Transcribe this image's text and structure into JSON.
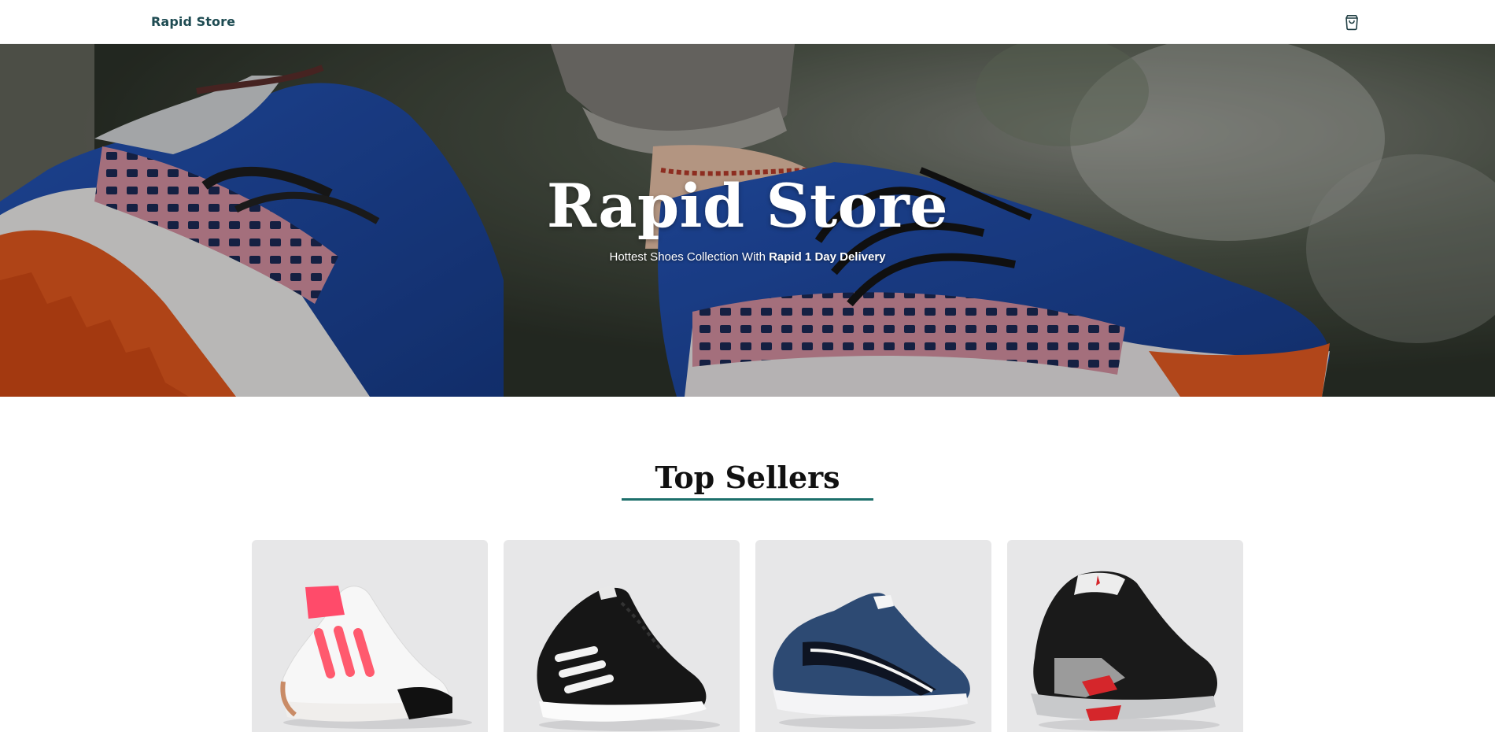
{
  "navbar": {
    "brand": "Rapid Store",
    "cart_icon": "shopping-bag-icon"
  },
  "hero": {
    "title": "Rapid Store",
    "subtitle_prefix": "Hottest Shoes Collection With ",
    "subtitle_emphasis": "Rapid 1 Day Delivery",
    "background_image": "sneaker-photo"
  },
  "section": {
    "title": "Top Sellers",
    "accent_color": "#1d6f6b"
  },
  "products": [
    {
      "image": "white-pink-running-shoe"
    },
    {
      "image": "black-white-stripe-shoe"
    },
    {
      "image": "navy-puma-shoe"
    },
    {
      "image": "black-grey-red-basketball-shoe"
    }
  ],
  "colors": {
    "brand_text": "#1e4b52",
    "card_background": "#e7e7e8"
  }
}
